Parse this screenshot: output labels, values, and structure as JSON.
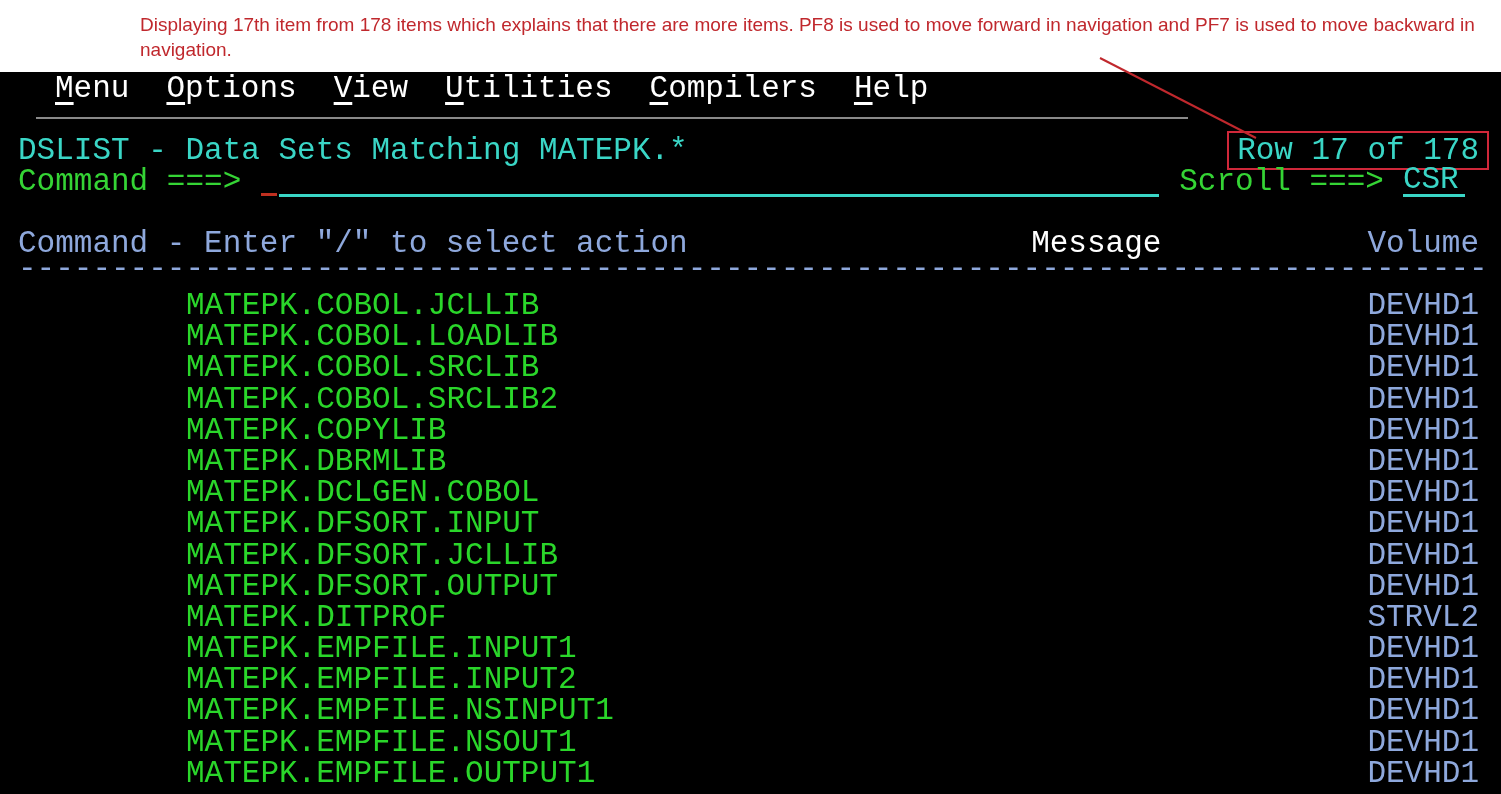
{
  "annotation": {
    "text": "Displaying 17th item from 178 items which explains that there are more items. PF8 is used to move forward in navigation and PF7 is used to move backward in navigation."
  },
  "menu": [
    {
      "label": "Menu"
    },
    {
      "label": "Options"
    },
    {
      "label": "View"
    },
    {
      "label": "Utilities"
    },
    {
      "label": "Compilers"
    },
    {
      "label": "Help"
    }
  ],
  "panel": {
    "title": "DSLIST - Data Sets Matching MATEPK.*",
    "row_info": "Row 17 of 178",
    "command_label": "Command ===>",
    "scroll_label": "Scroll ===>",
    "scroll_value": "CSR"
  },
  "columns": {
    "command": "Command - Enter \"/\" to select action",
    "message": "Message",
    "volume": "Volume"
  },
  "separator": "-------------------------------------------------------------------------------",
  "rows": [
    {
      "name": "MATEPK.COBOL.JCLLIB",
      "volume": "DEVHD1"
    },
    {
      "name": "MATEPK.COBOL.LOADLIB",
      "volume": "DEVHD1"
    },
    {
      "name": "MATEPK.COBOL.SRCLIB",
      "volume": "DEVHD1"
    },
    {
      "name": "MATEPK.COBOL.SRCLIB2",
      "volume": "DEVHD1"
    },
    {
      "name": "MATEPK.COPYLIB",
      "volume": "DEVHD1"
    },
    {
      "name": "MATEPK.DBRMLIB",
      "volume": "DEVHD1"
    },
    {
      "name": "MATEPK.DCLGEN.COBOL",
      "volume": "DEVHD1"
    },
    {
      "name": "MATEPK.DFSORT.INPUT",
      "volume": "DEVHD1"
    },
    {
      "name": "MATEPK.DFSORT.JCLLIB",
      "volume": "DEVHD1"
    },
    {
      "name": "MATEPK.DFSORT.OUTPUT",
      "volume": "DEVHD1"
    },
    {
      "name": "MATEPK.DITPROF",
      "volume": "STRVL2"
    },
    {
      "name": "MATEPK.EMPFILE.INPUT1",
      "volume": "DEVHD1"
    },
    {
      "name": "MATEPK.EMPFILE.INPUT2",
      "volume": "DEVHD1"
    },
    {
      "name": "MATEPK.EMPFILE.NSINPUT1",
      "volume": "DEVHD1"
    },
    {
      "name": "MATEPK.EMPFILE.NSOUT1",
      "volume": "DEVHD1"
    },
    {
      "name": "MATEPK.EMPFILE.OUTPUT1",
      "volume": "DEVHD1"
    }
  ]
}
